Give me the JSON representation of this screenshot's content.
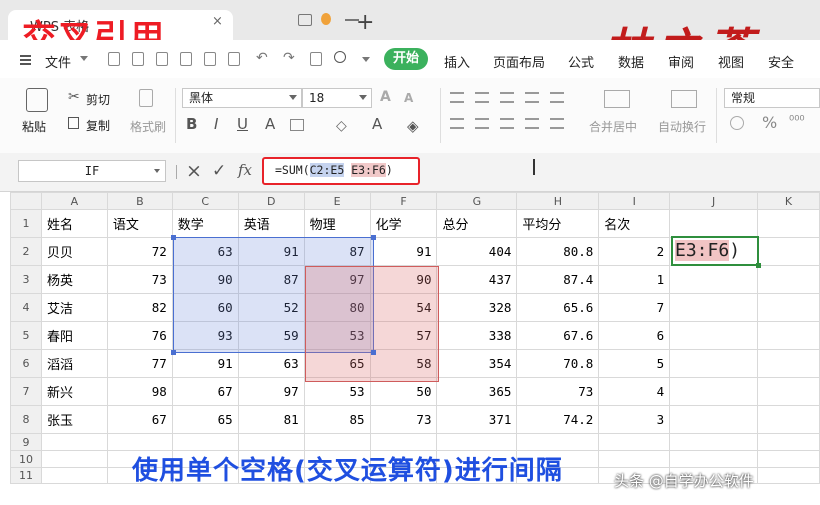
{
  "tab": {
    "title": "WPS 表格",
    "close": "×",
    "new": "+"
  },
  "overlay": {
    "title": "交叉引用",
    "signature": "林之蒼"
  },
  "menu": {
    "file": "文件",
    "items": [
      "开始",
      "插入",
      "页面布局",
      "公式",
      "数据",
      "审阅",
      "视图",
      "安全"
    ]
  },
  "ribbon": {
    "paste": "粘贴",
    "cut": "剪切",
    "copy": "复制",
    "format_painter": "格式刷",
    "font_name": "黑体",
    "font_size": "18",
    "merge": "合并居中",
    "wrap": "自动换行",
    "number_format": "常规"
  },
  "formula_bar": {
    "name_box": "IF",
    "cancel": "×",
    "confirm": "✓",
    "fx": "fx",
    "formula_prefix": "=SUM(",
    "ref1": "C2:E5",
    "space": " ",
    "ref2": "E3:F6",
    "formula_suffix": ")"
  },
  "sheet": {
    "columns": [
      "A",
      "B",
      "C",
      "D",
      "E",
      "F",
      "G",
      "H",
      "I",
      "J",
      "K"
    ],
    "header": [
      "姓名",
      "语文",
      "数学",
      "英语",
      "物理",
      "化学",
      "总分",
      "平均分",
      "名次"
    ],
    "rows": [
      [
        "贝贝",
        "72",
        "63",
        "91",
        "87",
        "91",
        "404",
        "80.8",
        "2"
      ],
      [
        "杨英",
        "73",
        "90",
        "87",
        "97",
        "90",
        "437",
        "87.4",
        "1"
      ],
      [
        "艾洁",
        "82",
        "60",
        "52",
        "80",
        "54",
        "328",
        "65.6",
        "7"
      ],
      [
        "春阳",
        "76",
        "93",
        "59",
        "53",
        "57",
        "338",
        "67.6",
        "6"
      ],
      [
        "滔滔",
        "77",
        "91",
        "63",
        "65",
        "58",
        "354",
        "70.8",
        "5"
      ],
      [
        "新兴",
        "98",
        "67",
        "97",
        "53",
        "50",
        "365",
        "73",
        "4"
      ],
      [
        "张玉",
        "67",
        "65",
        "81",
        "85",
        "73",
        "371",
        "74.2",
        "3"
      ]
    ],
    "active_cell_ref": "E3:F6",
    "active_cell_suffix": ")"
  },
  "caption": "使用单个空格(交叉运算符)进行间隔",
  "watermark": "头条 @自学办公软件"
}
